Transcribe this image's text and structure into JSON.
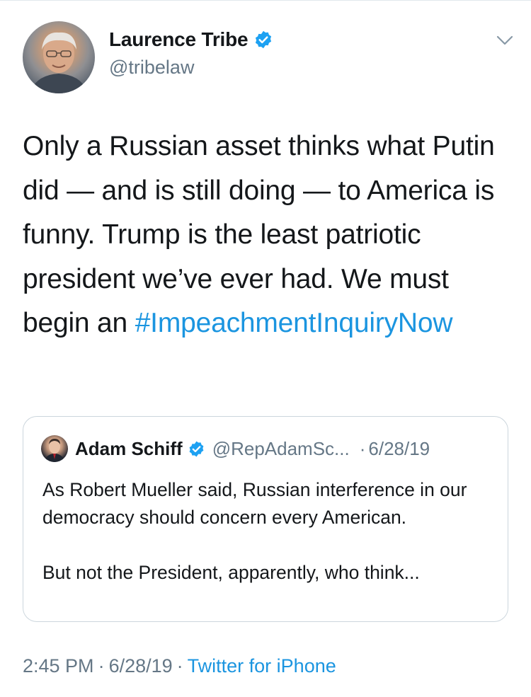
{
  "tweet": {
    "author": {
      "display_name": "Laurence Tribe",
      "handle": "@tribelaw",
      "verified": true,
      "avatar_icon": "profile-photo"
    },
    "text": "Only a Russian asset thinks what Putin did — and is still doing — to America is funny. Trump is the least patriotic president we’ve ever had. We must begin an",
    "hashtag": "#ImpeachmentInquiryNow",
    "menu_icon": "chevron-down-icon",
    "quoted": {
      "display_name": "Adam Schiff",
      "handle": "@RepAdamSc...",
      "separator": "·",
      "date": "6/28/19",
      "verified": true,
      "text": "As Robert Mueller said, Russian interference in our democracy should concern every American.\n\nBut not the President, apparently, who think..."
    },
    "footer": {
      "time": "2:45 PM",
      "separator": "·",
      "date": "6/28/19",
      "source": "Twitter for iPhone"
    }
  },
  "colors": {
    "text": "#14171a",
    "secondary": "#657786",
    "link": "#1b95e0",
    "verified": "#1da1f2",
    "border": "#ccd6dd"
  }
}
